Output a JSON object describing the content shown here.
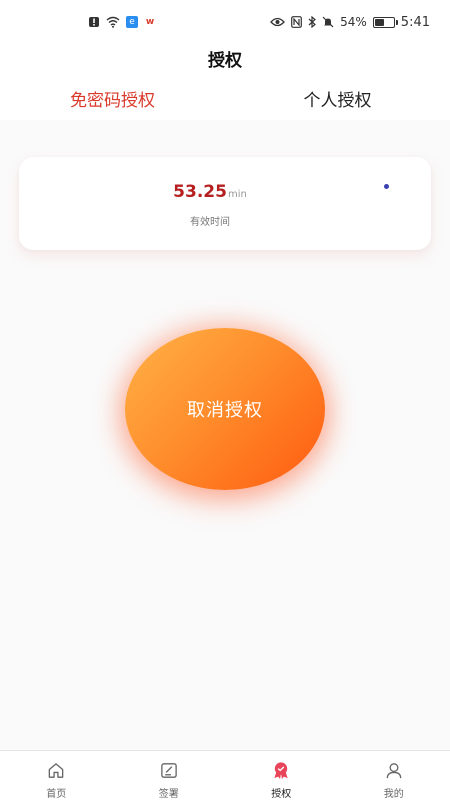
{
  "status_bar": {
    "battery_percent": "54%",
    "time": "5:41",
    "battery_level": 0.54,
    "left_icons": [
      "notification-alert-icon",
      "wifi-icon",
      "browser-app-icon",
      "wps-app-icon"
    ],
    "right_icons": [
      "eye-icon",
      "nfc-icon",
      "bluetooth-icon",
      "mute-bell-icon",
      "battery-icon"
    ]
  },
  "header": {
    "title": "授权"
  },
  "tabs": [
    {
      "label": "免密码授权",
      "active": true
    },
    {
      "label": "个人授权",
      "active": false
    }
  ],
  "card": {
    "value": "53.25",
    "unit": "min",
    "label": "有效时间"
  },
  "main_button": {
    "label": "取消授权"
  },
  "bottom_nav": [
    {
      "label": "首页",
      "icon": "home-icon"
    },
    {
      "label": "签署",
      "icon": "sign-icon"
    },
    {
      "label": "授权",
      "icon": "authorize-badge-icon",
      "active": true
    },
    {
      "label": "我的",
      "icon": "user-icon"
    }
  ],
  "colors": {
    "accent_red": "#d93a2b",
    "value_red": "#b51f1f",
    "button_gradient_start": "#ffb347",
    "button_gradient_end": "#ff5a10",
    "dot_blue": "#3b3fb0"
  }
}
